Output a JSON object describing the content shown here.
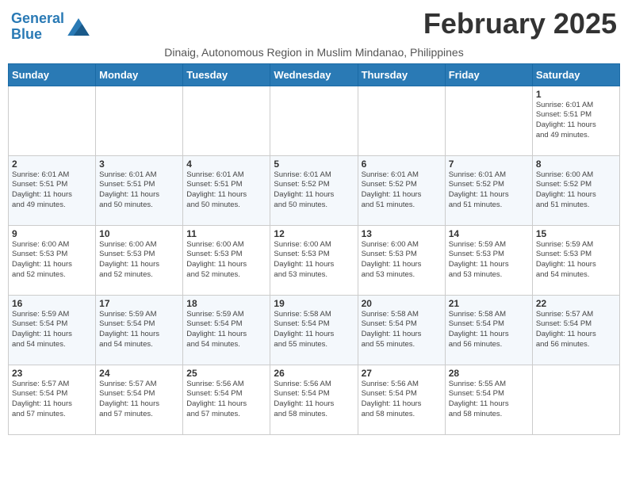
{
  "logo": {
    "line1": "General",
    "line2": "Blue",
    "icon_color": "#2a7ab5"
  },
  "title": "February 2025",
  "subtitle": "Dinaig, Autonomous Region in Muslim Mindanao, Philippines",
  "days_of_week": [
    "Sunday",
    "Monday",
    "Tuesday",
    "Wednesday",
    "Thursday",
    "Friday",
    "Saturday"
  ],
  "weeks": [
    {
      "row_class": "odd-row",
      "days": [
        {
          "num": "",
          "info": ""
        },
        {
          "num": "",
          "info": ""
        },
        {
          "num": "",
          "info": ""
        },
        {
          "num": "",
          "info": ""
        },
        {
          "num": "",
          "info": ""
        },
        {
          "num": "",
          "info": ""
        },
        {
          "num": "1",
          "info": "Sunrise: 6:01 AM\nSunset: 5:51 PM\nDaylight: 11 hours\nand 49 minutes."
        }
      ]
    },
    {
      "row_class": "even-row",
      "days": [
        {
          "num": "2",
          "info": "Sunrise: 6:01 AM\nSunset: 5:51 PM\nDaylight: 11 hours\nand 49 minutes."
        },
        {
          "num": "3",
          "info": "Sunrise: 6:01 AM\nSunset: 5:51 PM\nDaylight: 11 hours\nand 50 minutes."
        },
        {
          "num": "4",
          "info": "Sunrise: 6:01 AM\nSunset: 5:51 PM\nDaylight: 11 hours\nand 50 minutes."
        },
        {
          "num": "5",
          "info": "Sunrise: 6:01 AM\nSunset: 5:52 PM\nDaylight: 11 hours\nand 50 minutes."
        },
        {
          "num": "6",
          "info": "Sunrise: 6:01 AM\nSunset: 5:52 PM\nDaylight: 11 hours\nand 51 minutes."
        },
        {
          "num": "7",
          "info": "Sunrise: 6:01 AM\nSunset: 5:52 PM\nDaylight: 11 hours\nand 51 minutes."
        },
        {
          "num": "8",
          "info": "Sunrise: 6:00 AM\nSunset: 5:52 PM\nDaylight: 11 hours\nand 51 minutes."
        }
      ]
    },
    {
      "row_class": "odd-row",
      "days": [
        {
          "num": "9",
          "info": "Sunrise: 6:00 AM\nSunset: 5:53 PM\nDaylight: 11 hours\nand 52 minutes."
        },
        {
          "num": "10",
          "info": "Sunrise: 6:00 AM\nSunset: 5:53 PM\nDaylight: 11 hours\nand 52 minutes."
        },
        {
          "num": "11",
          "info": "Sunrise: 6:00 AM\nSunset: 5:53 PM\nDaylight: 11 hours\nand 52 minutes."
        },
        {
          "num": "12",
          "info": "Sunrise: 6:00 AM\nSunset: 5:53 PM\nDaylight: 11 hours\nand 53 minutes."
        },
        {
          "num": "13",
          "info": "Sunrise: 6:00 AM\nSunset: 5:53 PM\nDaylight: 11 hours\nand 53 minutes."
        },
        {
          "num": "14",
          "info": "Sunrise: 5:59 AM\nSunset: 5:53 PM\nDaylight: 11 hours\nand 53 minutes."
        },
        {
          "num": "15",
          "info": "Sunrise: 5:59 AM\nSunset: 5:53 PM\nDaylight: 11 hours\nand 54 minutes."
        }
      ]
    },
    {
      "row_class": "even-row",
      "days": [
        {
          "num": "16",
          "info": "Sunrise: 5:59 AM\nSunset: 5:54 PM\nDaylight: 11 hours\nand 54 minutes."
        },
        {
          "num": "17",
          "info": "Sunrise: 5:59 AM\nSunset: 5:54 PM\nDaylight: 11 hours\nand 54 minutes."
        },
        {
          "num": "18",
          "info": "Sunrise: 5:59 AM\nSunset: 5:54 PM\nDaylight: 11 hours\nand 54 minutes."
        },
        {
          "num": "19",
          "info": "Sunrise: 5:58 AM\nSunset: 5:54 PM\nDaylight: 11 hours\nand 55 minutes."
        },
        {
          "num": "20",
          "info": "Sunrise: 5:58 AM\nSunset: 5:54 PM\nDaylight: 11 hours\nand 55 minutes."
        },
        {
          "num": "21",
          "info": "Sunrise: 5:58 AM\nSunset: 5:54 PM\nDaylight: 11 hours\nand 56 minutes."
        },
        {
          "num": "22",
          "info": "Sunrise: 5:57 AM\nSunset: 5:54 PM\nDaylight: 11 hours\nand 56 minutes."
        }
      ]
    },
    {
      "row_class": "odd-row",
      "days": [
        {
          "num": "23",
          "info": "Sunrise: 5:57 AM\nSunset: 5:54 PM\nDaylight: 11 hours\nand 57 minutes."
        },
        {
          "num": "24",
          "info": "Sunrise: 5:57 AM\nSunset: 5:54 PM\nDaylight: 11 hours\nand 57 minutes."
        },
        {
          "num": "25",
          "info": "Sunrise: 5:56 AM\nSunset: 5:54 PM\nDaylight: 11 hours\nand 57 minutes."
        },
        {
          "num": "26",
          "info": "Sunrise: 5:56 AM\nSunset: 5:54 PM\nDaylight: 11 hours\nand 58 minutes."
        },
        {
          "num": "27",
          "info": "Sunrise: 5:56 AM\nSunset: 5:54 PM\nDaylight: 11 hours\nand 58 minutes."
        },
        {
          "num": "28",
          "info": "Sunrise: 5:55 AM\nSunset: 5:54 PM\nDaylight: 11 hours\nand 58 minutes."
        },
        {
          "num": "",
          "info": ""
        }
      ]
    }
  ]
}
